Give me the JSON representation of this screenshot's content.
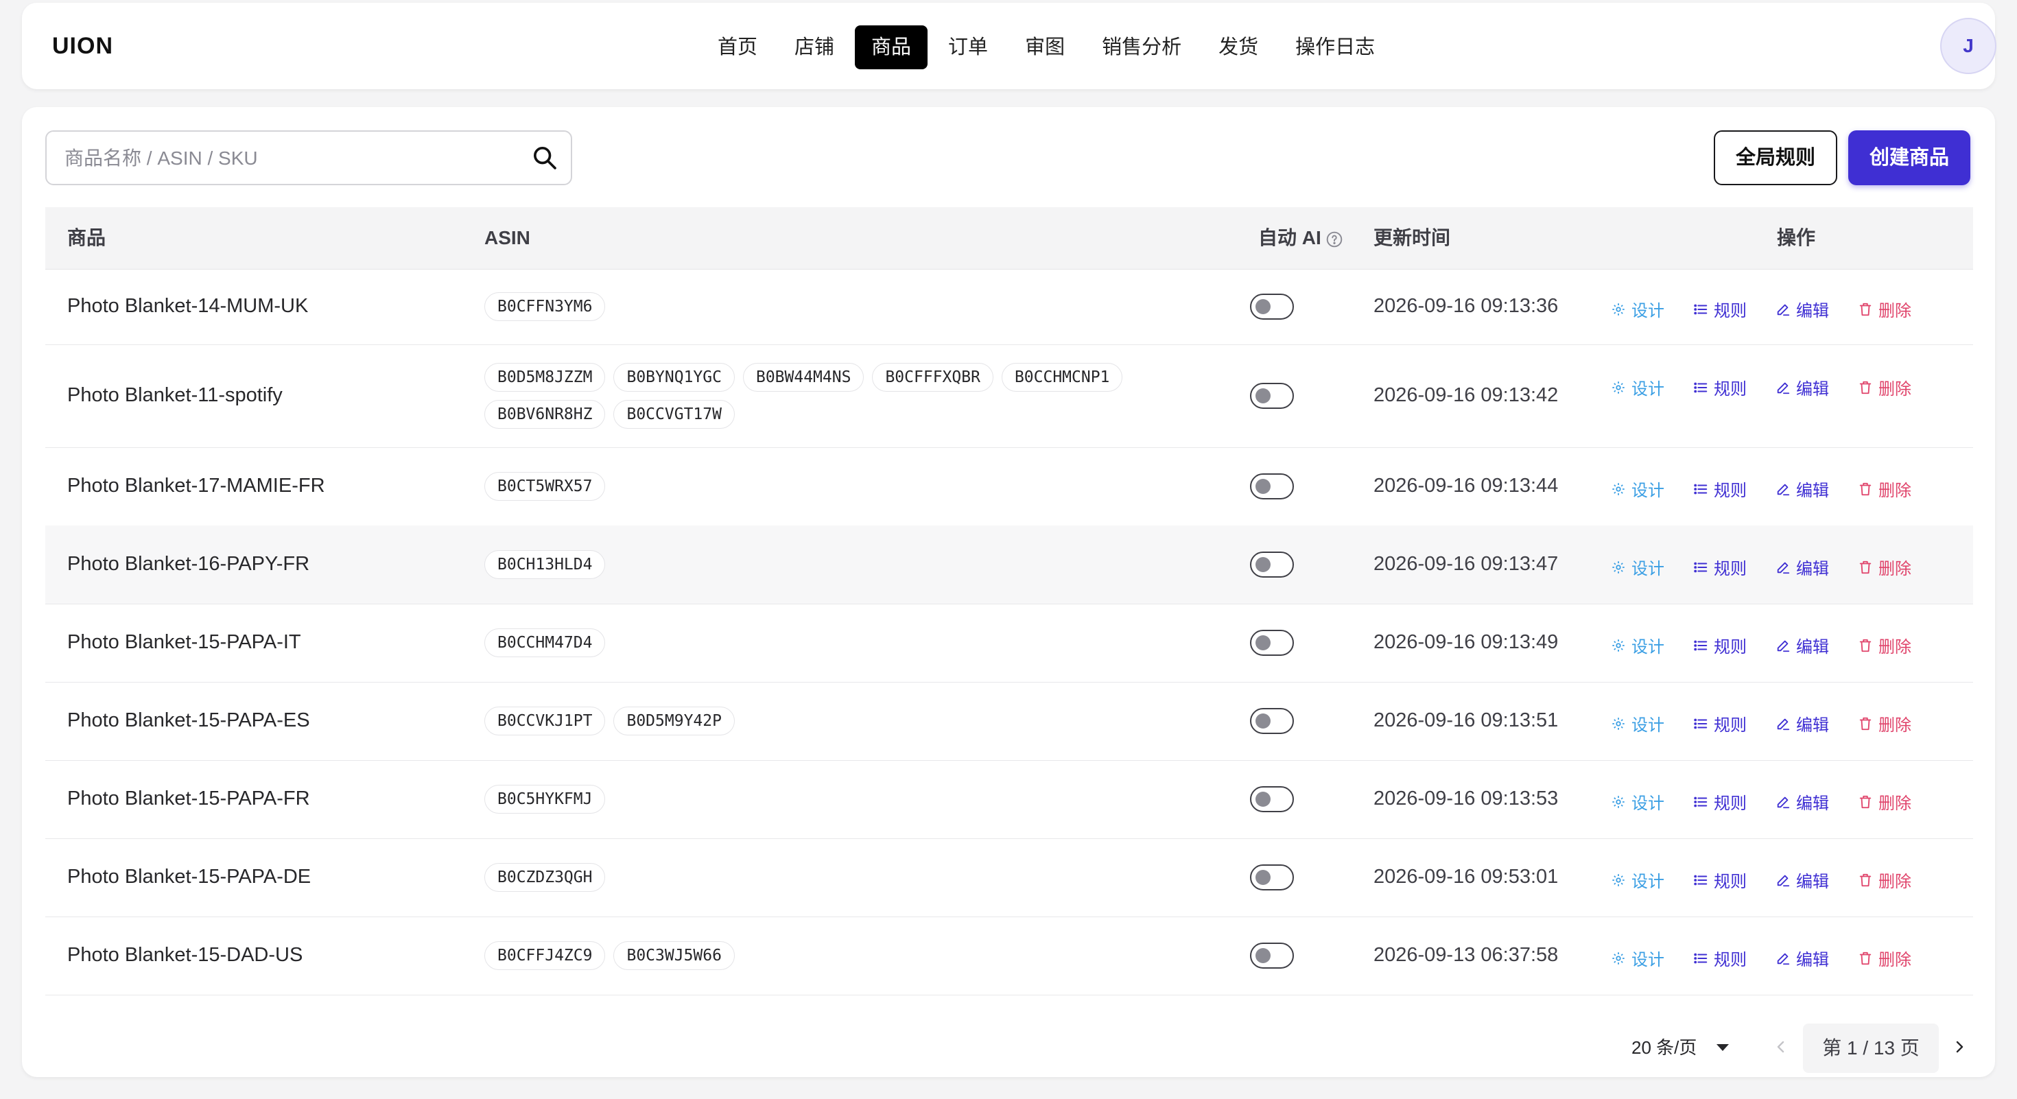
{
  "app": {
    "logo": "UION",
    "avatar_initial": "J"
  },
  "nav": [
    {
      "label": "首页",
      "active": false
    },
    {
      "label": "店铺",
      "active": false
    },
    {
      "label": "商品",
      "active": true
    },
    {
      "label": "订单",
      "active": false
    },
    {
      "label": "审图",
      "active": false
    },
    {
      "label": "销售分析",
      "active": false
    },
    {
      "label": "发货",
      "active": false
    },
    {
      "label": "操作日志",
      "active": false
    }
  ],
  "toolbar": {
    "search_placeholder": "商品名称 / ASIN / SKU",
    "global_rules_label": "全局规则",
    "create_label": "创建商品"
  },
  "table": {
    "headers": {
      "product": "商品",
      "asin": "ASIN",
      "auto_ai": "自动 AI",
      "updated": "更新时间",
      "actions": "操作"
    },
    "action_labels": {
      "design": "设计",
      "rule": "规则",
      "edit": "编辑",
      "delete": "删除"
    },
    "rows": [
      {
        "name": "Photo Blanket-14-MUM-UK",
        "asins": [
          "B0CFFN3YM6"
        ],
        "auto_ai": false,
        "updated": "2026-09-16 09:13:36"
      },
      {
        "name": "Photo Blanket-11-spotify",
        "asins": [
          "B0D5M8JZZM",
          "B0BYNQ1YGC",
          "B0BW44M4NS",
          "B0CFFFXQBR",
          "B0CCHMCNP1",
          "B0BV6NR8HZ",
          "B0CCVGT17W"
        ],
        "auto_ai": false,
        "updated": "2026-09-16 09:13:42"
      },
      {
        "name": "Photo Blanket-17-MAMIE-FR",
        "asins": [
          "B0CT5WRX57"
        ],
        "auto_ai": false,
        "updated": "2026-09-16 09:13:44"
      },
      {
        "name": "Photo Blanket-16-PAPY-FR",
        "asins": [
          "B0CH13HLD4"
        ],
        "auto_ai": false,
        "updated": "2026-09-16 09:13:47"
      },
      {
        "name": "Photo Blanket-15-PAPA-IT",
        "asins": [
          "B0CCHM47D4"
        ],
        "auto_ai": false,
        "updated": "2026-09-16 09:13:49"
      },
      {
        "name": "Photo Blanket-15-PAPA-ES",
        "asins": [
          "B0CCVKJ1PT",
          "B0D5M9Y42P"
        ],
        "auto_ai": false,
        "updated": "2026-09-16 09:13:51"
      },
      {
        "name": "Photo Blanket-15-PAPA-FR",
        "asins": [
          "B0C5HYKFMJ"
        ],
        "auto_ai": false,
        "updated": "2026-09-16 09:13:53"
      },
      {
        "name": "Photo Blanket-15-PAPA-DE",
        "asins": [
          "B0CZDZ3QGH"
        ],
        "auto_ai": false,
        "updated": "2026-09-16 09:53:01"
      },
      {
        "name": "Photo Blanket-15-DAD-US",
        "asins": [
          "B0CFFJ4ZC9",
          "B0C3WJ5W66"
        ],
        "auto_ai": false,
        "updated": "2026-09-13 06:37:58"
      }
    ]
  },
  "pagination": {
    "page_size_label": "20 条/页",
    "page_info": "第 1 / 13 页"
  }
}
